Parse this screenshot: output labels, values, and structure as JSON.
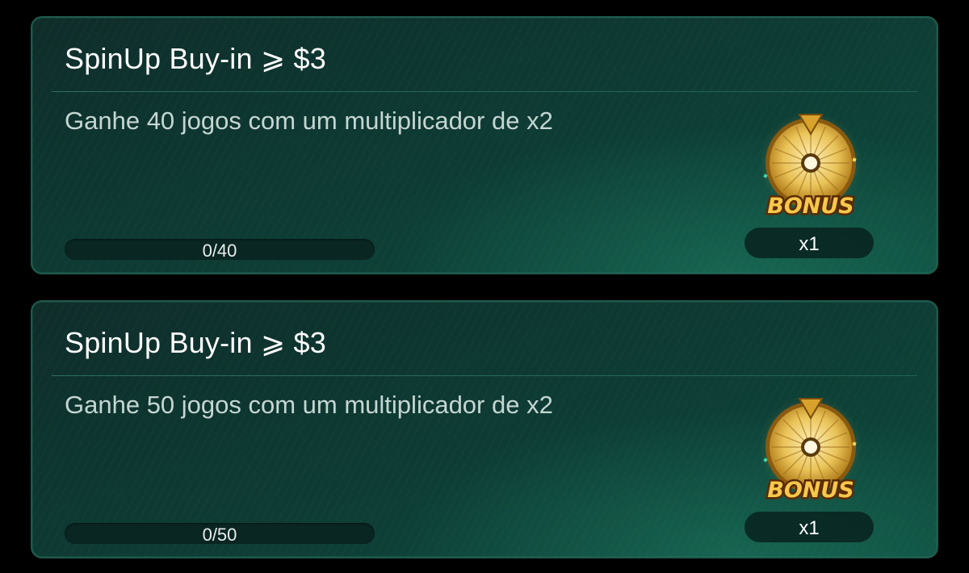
{
  "tasks": [
    {
      "title": "SpinUp Buy-in ⩾ $3",
      "description": "Ganhe 40 jogos com um multiplicador de x2",
      "progress": {
        "current": 0,
        "target": 40,
        "label": "0/40",
        "fraction": 0
      },
      "reward": {
        "icon": "bonus-wheel-icon",
        "badge_text": "BONUS",
        "quantity": "x1"
      }
    },
    {
      "title": "SpinUp Buy-in ⩾ $3",
      "description": "Ganhe 50 jogos com um multiplicador de x2",
      "progress": {
        "current": 0,
        "target": 50,
        "label": "0/50",
        "fraction": 0
      },
      "reward": {
        "icon": "bonus-wheel-icon",
        "badge_text": "BONUS",
        "quantity": "x1"
      }
    }
  ],
  "colors": {
    "card_bg": "#0e3a33",
    "card_border": "#1f5a4c",
    "title": "#ffffff",
    "description": "#c5d6d2",
    "wheel_gold": "#e8b53a",
    "bonus_text": "#f6c84a"
  }
}
